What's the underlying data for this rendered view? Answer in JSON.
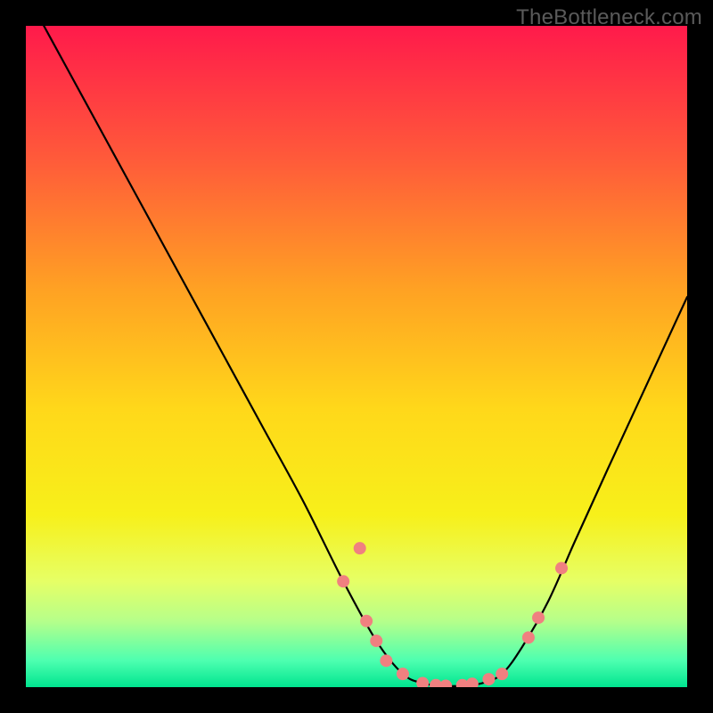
{
  "watermark": "TheBottleneck.com",
  "chart_data": {
    "type": "line",
    "title": "",
    "xlabel": "",
    "ylabel": "",
    "xlim": [
      0,
      100
    ],
    "ylim": [
      0,
      100
    ],
    "background": {
      "kind": "vertical-gradient",
      "stops": [
        {
          "offset": 0,
          "color": "#ff1a4b"
        },
        {
          "offset": 20,
          "color": "#ff5a3a"
        },
        {
          "offset": 40,
          "color": "#ffa223"
        },
        {
          "offset": 58,
          "color": "#ffd81a"
        },
        {
          "offset": 74,
          "color": "#f7f01a"
        },
        {
          "offset": 84,
          "color": "#e6ff66"
        },
        {
          "offset": 90,
          "color": "#b6ff8a"
        },
        {
          "offset": 96,
          "color": "#4dffb0"
        },
        {
          "offset": 100,
          "color": "#00e58f"
        }
      ]
    },
    "curve": {
      "description": "smooth V-shaped bottleneck curve with flat minimum",
      "x": [
        0,
        6,
        12,
        18,
        24,
        30,
        36,
        42,
        48,
        53,
        57,
        60,
        63,
        66,
        69,
        72,
        75,
        79,
        83,
        88,
        94,
        100
      ],
      "y": [
        105,
        94,
        83,
        72,
        61,
        50,
        39,
        28,
        16,
        7,
        2,
        0.6,
        0.2,
        0.2,
        0.6,
        2,
        6,
        13,
        22,
        33,
        46,
        59
      ]
    },
    "markers": {
      "color": "#f08080",
      "radius": 7,
      "points": [
        {
          "x": 48.0,
          "y": 16.0
        },
        {
          "x": 50.5,
          "y": 21.0
        },
        {
          "x": 51.5,
          "y": 10.0
        },
        {
          "x": 53.0,
          "y": 7.0
        },
        {
          "x": 54.5,
          "y": 4.0
        },
        {
          "x": 57.0,
          "y": 2.0
        },
        {
          "x": 60.0,
          "y": 0.6
        },
        {
          "x": 62.0,
          "y": 0.3
        },
        {
          "x": 63.5,
          "y": 0.2
        },
        {
          "x": 66.0,
          "y": 0.3
        },
        {
          "x": 67.5,
          "y": 0.5
        },
        {
          "x": 70.0,
          "y": 1.2
        },
        {
          "x": 72.0,
          "y": 2.0
        },
        {
          "x": 76.0,
          "y": 7.5
        },
        {
          "x": 77.5,
          "y": 10.5
        },
        {
          "x": 81.0,
          "y": 18.0
        }
      ]
    }
  }
}
